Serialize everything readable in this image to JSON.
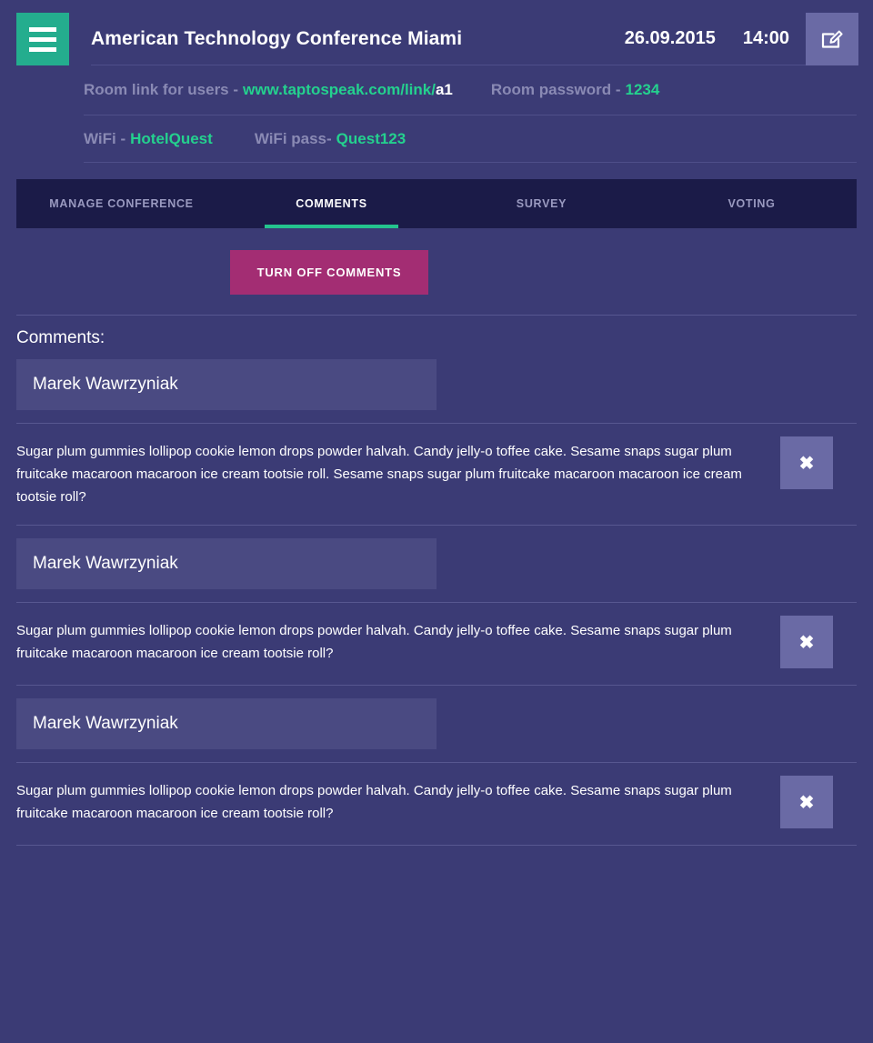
{
  "header": {
    "menu_icon": "hamburger-menu-icon",
    "title": "American Technology Conference Miami",
    "date": "26.09.2015",
    "time": "14:00",
    "edit_icon": "edit-pencil-icon"
  },
  "room_info": {
    "link_label": "Room link for users -",
    "link_value": "www.taptospeak.com/link/",
    "link_suffix": "a1",
    "password_label": "Room password -",
    "password_value": "1234"
  },
  "wifi_info": {
    "ssid_label": "WiFi -",
    "ssid_value": "HotelQuest",
    "pass_label": "WiFi pass-",
    "pass_value": "Quest123"
  },
  "tabs": [
    {
      "label": "MANAGE CONFERENCE",
      "active": false
    },
    {
      "label": "COMMENTS",
      "active": true
    },
    {
      "label": "SURVEY",
      "active": false
    },
    {
      "label": "VOTING",
      "active": false
    }
  ],
  "action": {
    "turn_off_comments_label": "TURN OFF COMMENTS"
  },
  "comments_section": {
    "heading": "Comments:",
    "delete_icon": "close-x-icon",
    "items": [
      {
        "author": "Marek Wawrzyniak",
        "text": "Sugar plum gummies lollipop cookie lemon drops powder halvah. Candy jelly-o toffee cake. Sesame snaps sugar plum fruitcake macaroon macaroon ice cream tootsie roll. Sesame snaps sugar plum fruitcake macaroon macaroon ice cream tootsie roll?"
      },
      {
        "author": "Marek Wawrzyniak",
        "text": "Sugar plum gummies lollipop cookie lemon drops powder halvah. Candy jelly-o toffee cake. Sesame snaps sugar plum fruitcake macaroon macaroon ice cream tootsie roll?"
      },
      {
        "author": "Marek Wawrzyniak",
        "text": "Sugar plum gummies lollipop cookie lemon drops powder halvah. Candy jelly-o toffee cake. Sesame snaps sugar plum fruitcake macaroon macaroon ice cream tootsie roll?"
      }
    ]
  },
  "colors": {
    "background": "#3b3b75",
    "tabbar": "#1b1b48",
    "accent_green": "#24d18e",
    "accent_magenta": "#a32d73",
    "field": "#4a4a82",
    "button_purple": "#6a6aa5",
    "muted_text": "#8a8ab4"
  }
}
